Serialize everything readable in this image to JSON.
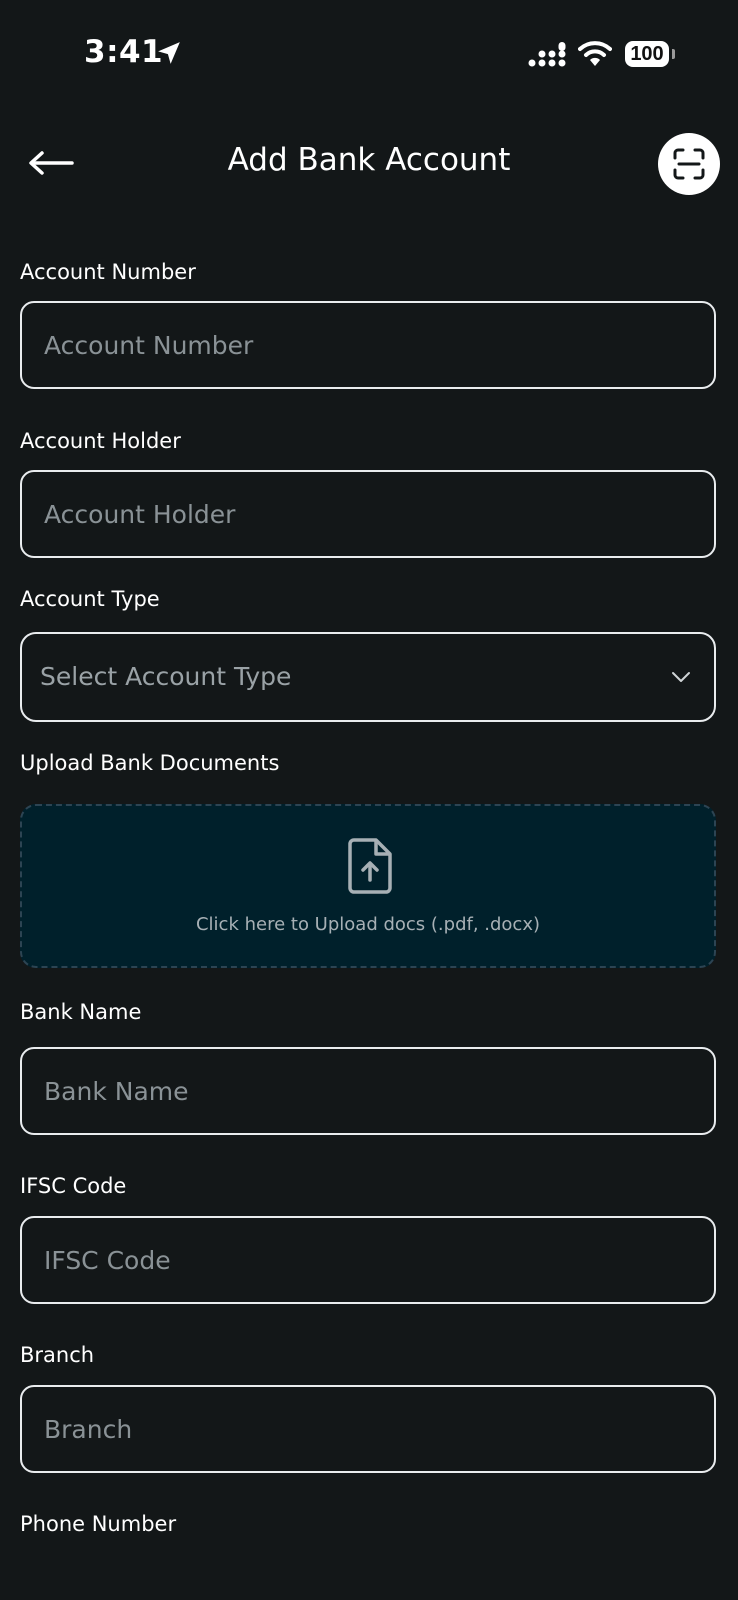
{
  "status_bar": {
    "time": "3:41",
    "battery": "100",
    "icons": [
      "location-arrow-icon",
      "signal-bars-icon",
      "wifi-icon",
      "battery-icon"
    ]
  },
  "header": {
    "title": "Add Bank Account",
    "back_icon": "arrow-left-icon",
    "scan_icon": "scan-icon"
  },
  "form": {
    "account_number": {
      "label": "Account Number",
      "placeholder": "Account Number",
      "value": ""
    },
    "account_holder": {
      "label": "Account Holder",
      "placeholder": "Account Holder",
      "value": ""
    },
    "account_type": {
      "label": "Account Type",
      "selected": "Select Account Type"
    },
    "upload": {
      "label": "Upload Bank Documents",
      "text": "Click here to Upload docs (.pdf, .docx)",
      "icon": "file-upload-icon"
    },
    "bank_name": {
      "label": "Bank Name",
      "placeholder": "Bank Name",
      "value": ""
    },
    "ifsc_code": {
      "label": "IFSC Code",
      "placeholder": "IFSC Code",
      "value": ""
    },
    "branch": {
      "label": "Branch",
      "placeholder": "Branch",
      "value": ""
    },
    "phone_number": {
      "label": "Phone Number"
    }
  },
  "colors": {
    "background": "#131718",
    "border": "#e9ecee",
    "placeholder": "#8a9296",
    "upload_bg": "#00202b"
  }
}
